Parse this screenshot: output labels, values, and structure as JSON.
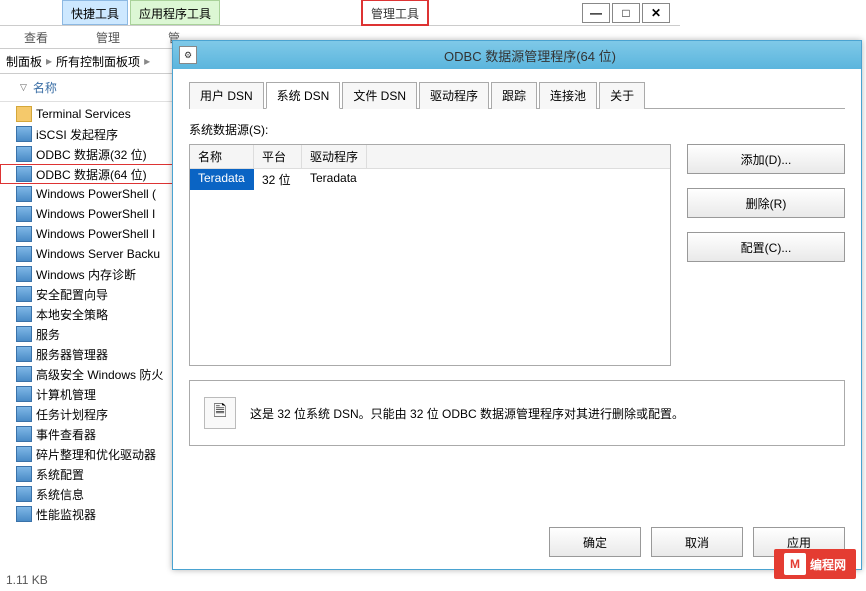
{
  "ribbon": {
    "quick_tools": "快捷工具",
    "app_tools": "应用程序工具",
    "admin_tools": "管理工具",
    "view": "查看",
    "manage": "管理",
    "manage2": "管"
  },
  "breadcrumb": {
    "p1": "制面板",
    "p2": "所有控制面板项",
    "sep": "▸"
  },
  "column_header": "名称",
  "files": [
    {
      "name": "Terminal Services",
      "type": "folder"
    },
    {
      "name": "iSCSI 发起程序",
      "type": "app"
    },
    {
      "name": "ODBC 数据源(32 位)",
      "type": "app"
    },
    {
      "name": "ODBC 数据源(64 位)",
      "type": "app",
      "hl": true
    },
    {
      "name": "Windows PowerShell (",
      "type": "app"
    },
    {
      "name": "Windows PowerShell I",
      "type": "app"
    },
    {
      "name": "Windows PowerShell I",
      "type": "app"
    },
    {
      "name": "Windows Server Backu",
      "type": "app"
    },
    {
      "name": "Windows 内存诊断",
      "type": "app"
    },
    {
      "name": "安全配置向导",
      "type": "app"
    },
    {
      "name": "本地安全策略",
      "type": "app"
    },
    {
      "name": "服务",
      "type": "app"
    },
    {
      "name": "服务器管理器",
      "type": "app"
    },
    {
      "name": "高级安全 Windows 防火",
      "type": "app"
    },
    {
      "name": "计算机管理",
      "type": "app"
    },
    {
      "name": "任务计划程序",
      "type": "app"
    },
    {
      "name": "事件查看器",
      "type": "app"
    },
    {
      "name": "碎片整理和优化驱动器",
      "type": "app"
    },
    {
      "name": "系统配置",
      "type": "app"
    },
    {
      "name": "系统信息",
      "type": "app"
    },
    {
      "name": "性能监视器",
      "type": "app"
    }
  ],
  "status": "1.11 KB",
  "dialog": {
    "title": "ODBC 数据源管理程序(64 位)",
    "tabs": [
      "用户 DSN",
      "系统 DSN",
      "文件 DSN",
      "驱动程序",
      "跟踪",
      "连接池",
      "关于"
    ],
    "active_tab_index": 1,
    "list_label": "系统数据源(S):",
    "columns": [
      "名称",
      "平台",
      "驱动程序"
    ],
    "row": {
      "name": "Teradata",
      "platform": "32 位",
      "driver": "Teradata"
    },
    "btn_add": "添加(D)...",
    "btn_remove": "删除(R)",
    "btn_config": "配置(C)...",
    "info_text": "这是 32 位系统 DSN。只能由 32 位 ODBC 数据源管理程序对其进行删除或配置。",
    "btn_ok": "确定",
    "btn_cancel": "取消",
    "btn_apply": "应用"
  },
  "watermark": "编程网",
  "title_buttons": {
    "min": "—",
    "max": "□",
    "close": "✕"
  }
}
